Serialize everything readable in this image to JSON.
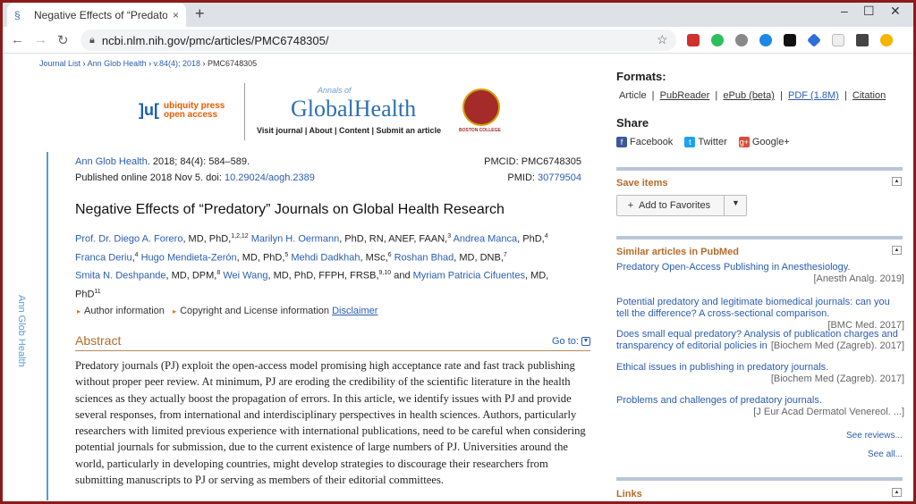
{
  "browser": {
    "tab_title": "Negative Effects of “Predatory” Jo",
    "url": "ncbi.nlm.nih.gov/pmc/articles/PMC6748305/",
    "new_tab": "+",
    "close_tab": "×",
    "minimize": "–",
    "maximize": "☐",
    "close_window": "✕"
  },
  "breadcrumb": {
    "journal_list": "Journal List",
    "journal": "Ann Glob Health",
    "volume": "v.84(4); 2018",
    "pmc": "PMC6748305",
    "sep": "›"
  },
  "banner": {
    "publisher_mark": "]u[",
    "publisher_name_1": "ubiquity press",
    "publisher_name_2": "open access",
    "journal_annals": "Annals of",
    "journal_title": "GlobalHealth",
    "nav": "Visit journal  |  About  |  Content  |  Submit an article",
    "college": "BOSTON COLLEGE"
  },
  "side_label": "Ann Glob Health",
  "citation": {
    "journal_link": "Ann Glob Health",
    "ref": ". 2018; 84(4): 584–589.",
    "pmcid": "PMCID: PMC6748305",
    "published": "Published online 2018 Nov 5. doi: ",
    "doi": "10.29024/aogh.2389",
    "pmid_label": "PMID: ",
    "pmid": "30779504"
  },
  "title": "Negative Effects of “Predatory” Journals on Global Health Research",
  "authors": [
    {
      "name": "Prof. Dr. Diego A. Forero",
      "deg": ", MD, PhD,",
      "sup": "1,2,12"
    },
    {
      "name": "Marilyn H. Oermann",
      "deg": ", PhD, RN, ANEF, FAAN,",
      "sup": "3"
    },
    {
      "name": "Andrea Manca",
      "deg": ", PhD,",
      "sup": "4"
    },
    {
      "name": "Franca Deriu",
      "deg": ",",
      "sup": "4"
    },
    {
      "name": "Hugo Mendieta-Zerón",
      "deg": ", MD, PhD,",
      "sup": "5"
    },
    {
      "name": "Mehdi Dadkhah",
      "deg": ", MSc,",
      "sup": "6"
    },
    {
      "name": "Roshan Bhad",
      "deg": ", MD, DNB,",
      "sup": "7"
    },
    {
      "name": "Smita N. Deshpande",
      "deg": ", MD, DPM,",
      "sup": "8"
    },
    {
      "name": "Wei Wang",
      "deg": ", MD, PhD, FFPH, FRSB,",
      "sup": "9,10"
    },
    {
      "name": "Myriam Patricia Cifuentes",
      "deg": ", MD, PhD",
      "sup": "11"
    }
  ],
  "authors_and": " and ",
  "info": {
    "author_info": "Author information",
    "copyright": "Copyright and License information",
    "disclaimer": "Disclaimer"
  },
  "abstract": {
    "heading": "Abstract",
    "goto": "Go to:",
    "text": "Predatory journals (PJ) exploit the open-access model promising high acceptance rate and fast track publishing without proper peer review. At minimum, PJ are eroding the credibility of the scientific literature in the health sciences as they actually boost the propagation of errors. In this article, we identify issues with PJ and provide several responses, from international and interdisciplinary perspectives in health sciences. Authors, particularly researchers with limited previous experience with international publications, need to be careful when considering potential journals for submission, due to the current existence of large numbers of PJ. Universities around the world, particularly in developing countries, might develop strategies to discourage their researchers from submitting manuscripts to PJ or serving as members of their editorial committees."
  },
  "right": {
    "formats_heading": "Formats:",
    "formats": [
      {
        "label": "Article",
        "link": false
      },
      {
        "label": "PubReader",
        "link": true
      },
      {
        "label": "ePub (beta)",
        "link": true
      },
      {
        "label": "PDF (1.8M)",
        "link": true
      },
      {
        "label": "Citation",
        "link": true
      }
    ],
    "share_heading": "Share",
    "share": [
      {
        "label": "Facebook",
        "icon": "f",
        "color": "#3b5998"
      },
      {
        "label": "Twitter",
        "icon": "t",
        "color": "#1da1f2"
      },
      {
        "label": "Google+",
        "icon": "g+",
        "color": "#dd4b39"
      }
    ],
    "save_heading": "Save items",
    "add_favorites": "Add to Favorites",
    "similar_heading": "Similar articles in PubMed",
    "similar": [
      {
        "title": "Predatory Open-Access Publishing in Anesthesiology.",
        "source": "[Anesth Analg. 2019]"
      },
      {
        "title": "Potential predatory and legitimate biomedical journals: can you tell the difference? A cross-sectional comparison.",
        "source": "[BMC Med. 2017]"
      },
      {
        "title": "Does small equal predatory? Analysis of publication charges and transparency of editorial policies in",
        "source": "[Biochem Med (Zagreb). 2017]"
      },
      {
        "title": "Ethical issues in publishing in predatory journals.",
        "source": "[Biochem Med (Zagreb). 2017]"
      },
      {
        "title": "Problems and challenges of predatory journals.",
        "source": "[J Eur Acad Dermatol Venereol. ...]"
      }
    ],
    "see_reviews": "See reviews...",
    "see_all": "See all...",
    "links_heading": "Links"
  },
  "colors": {
    "accent_link": "#2a5db0",
    "section_heading": "#b56b28",
    "frame": "#8b1a1a"
  }
}
